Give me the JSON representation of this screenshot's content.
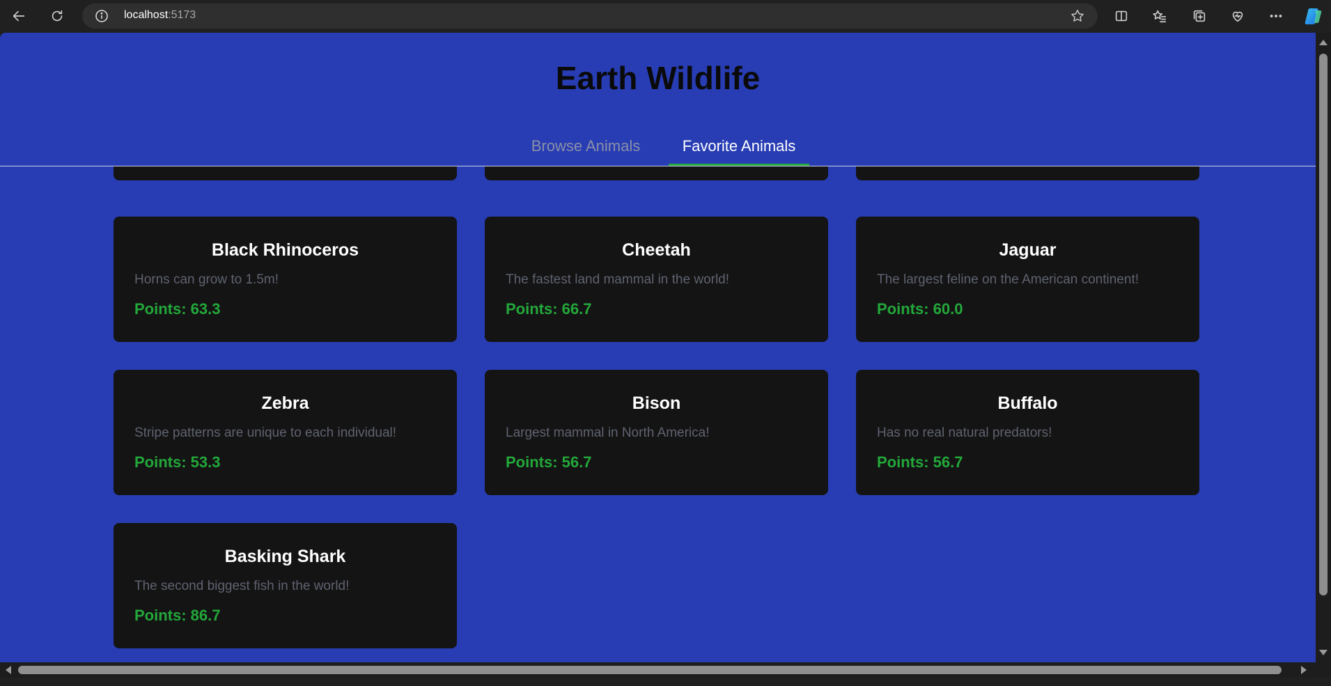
{
  "browser": {
    "url_host": "localhost",
    "url_port": ":5173",
    "icons": [
      "back-arrow-icon",
      "refresh-icon",
      "info-icon",
      "favorite-star-icon",
      "split-screen-icon",
      "favorites-icon",
      "collections-icon",
      "browser-essentials-icon",
      "more-icon",
      "copilot-icon"
    ]
  },
  "page": {
    "title": "Earth Wildlife",
    "tabs": [
      {
        "label": "Browse Animals",
        "active": false
      },
      {
        "label": "Favorite Animals",
        "active": true
      }
    ]
  },
  "colors": {
    "background": "#283db3",
    "card": "#141414",
    "accent": "#23a83a",
    "description": "#5f6270"
  },
  "animals": [
    {
      "name": "Black Rhinoceros",
      "description": "Horns can grow to 1.5m!",
      "points": "Points: 63.3"
    },
    {
      "name": "Cheetah",
      "description": "The fastest land mammal in the world!",
      "points": "Points: 66.7"
    },
    {
      "name": "Jaguar",
      "description": "The largest feline on the American continent!",
      "points": "Points: 60.0"
    },
    {
      "name": "Zebra",
      "description": "Stripe patterns are unique to each individual!",
      "points": "Points: 53.3"
    },
    {
      "name": "Bison",
      "description": "Largest mammal in North America!",
      "points": "Points: 56.7"
    },
    {
      "name": "Buffalo",
      "description": "Has no real natural predators!",
      "points": "Points: 56.7"
    },
    {
      "name": "Basking Shark",
      "description": "The second biggest fish in the world!",
      "points": "Points: 86.7"
    }
  ]
}
